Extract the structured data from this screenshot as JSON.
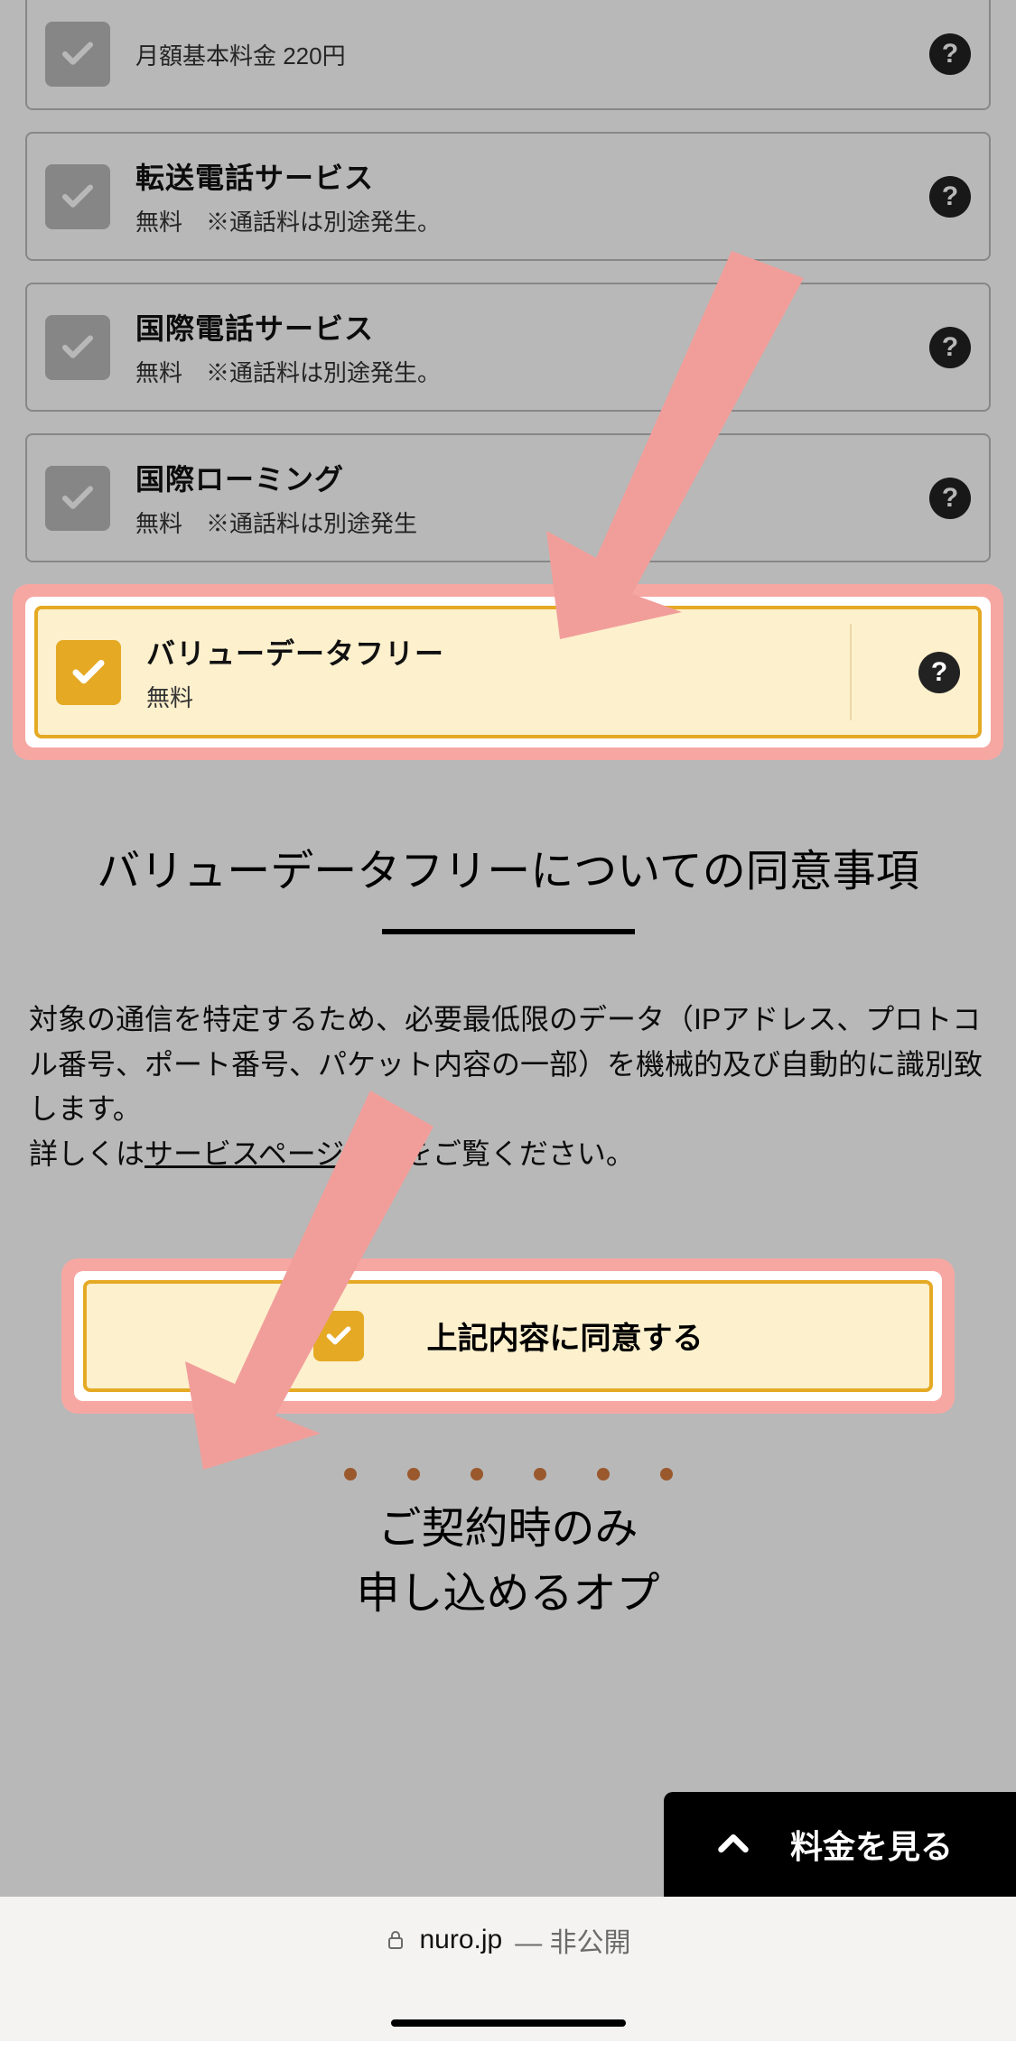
{
  "options": [
    {
      "title": "",
      "sub": "月額基本料金 220円",
      "checked": false
    },
    {
      "title": "転送電話サービス",
      "sub": "無料　※通話料は別途発生。",
      "checked": false
    },
    {
      "title": "国際電話サービス",
      "sub": "無料　※通話料は別途発生。",
      "checked": false
    },
    {
      "title": "国際ローミング",
      "sub": "無料　※通話料は別途発生",
      "checked": false
    },
    {
      "title": "バリューデータフリー",
      "sub": "無料",
      "checked": true
    }
  ],
  "agreement": {
    "heading": "バリューデータフリーについての同意事項",
    "body_line1": "対象の通信を特定するため、必要最低限のデータ（IPアドレス、プロトコル番号、ポート番号、パケット内容の一部）を機械的及び自動的に識別致します。",
    "body_prefix": "詳しくは",
    "link_text": "サービスページ",
    "body_suffix": "をご覧ください。",
    "button_label": "上記内容に同意する"
  },
  "bottom_section": {
    "line1": "ご契約時のみ",
    "line2": "申し込めるオプ"
  },
  "price_button": "料金を見る",
  "browser": {
    "domain": "nuro.jp",
    "status": "— 非公開"
  },
  "help_glyph": "?"
}
